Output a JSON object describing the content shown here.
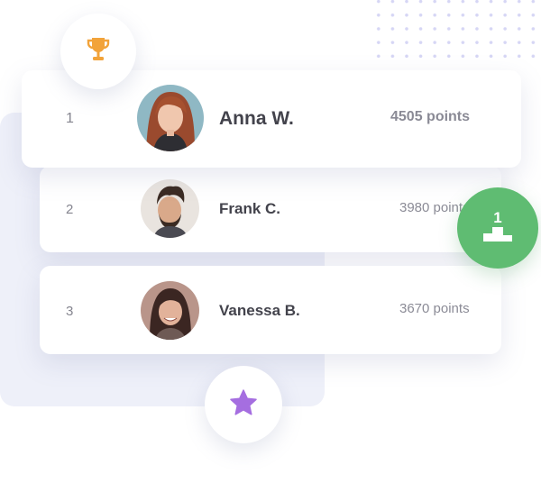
{
  "leaderboard": {
    "entries": [
      {
        "rank": "1",
        "name": "Anna W.",
        "points": "4505 points"
      },
      {
        "rank": "2",
        "name": "Frank C.",
        "points": "3980 points"
      },
      {
        "rank": "3",
        "name": "Vanessa B.",
        "points": "3670 points"
      }
    ]
  },
  "badges": {
    "trophy_icon": "trophy-icon",
    "star_icon": "star-icon",
    "podium_icon": "podium-icon",
    "podium_number": "1"
  },
  "colors": {
    "trophy": "#f2a33a",
    "star": "#a56ee0",
    "podium_bg": "#5fbc72",
    "panel_bg": "#eef0f9",
    "dots": "#d6d6f5"
  }
}
